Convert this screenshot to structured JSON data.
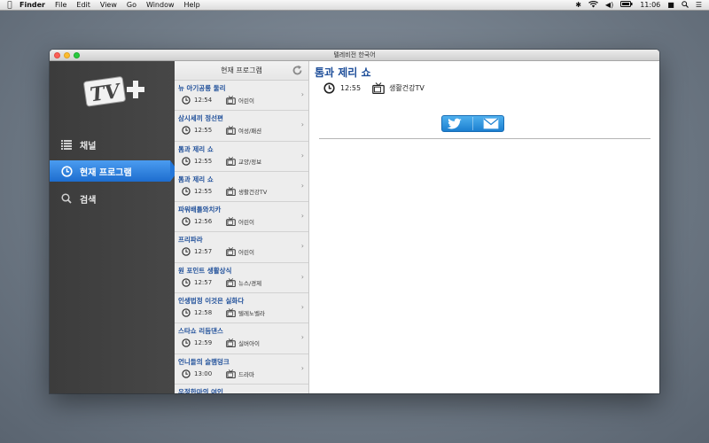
{
  "menubar": {
    "app_name": "Finder",
    "items": [
      "File",
      "Edit",
      "View",
      "Go",
      "Window",
      "Help"
    ],
    "clock": "11:06",
    "icons": [
      "apple-icon",
      "bluetooth-icon",
      "wifi-icon",
      "volume-icon",
      "battery-icon",
      "user-icon",
      "spotlight-icon",
      "notification-list-icon"
    ]
  },
  "window": {
    "title": "텔레비전 한국어"
  },
  "sidebar": {
    "logo_text": "TV",
    "items": [
      {
        "label": "채널",
        "icon": "list-icon"
      },
      {
        "label": "현재 프로그램",
        "icon": "clock-icon",
        "selected": true
      },
      {
        "label": "검색",
        "icon": "search-icon"
      }
    ]
  },
  "list": {
    "header": "현재 프로그램",
    "programs": [
      {
        "name": "뉴 아기공룡 둘리",
        "time": "12:54",
        "genre": "어린이"
      },
      {
        "name": "삼시세끼 정선편",
        "time": "12:55",
        "genre": "여성/패션"
      },
      {
        "name": "톰과 제리 쇼",
        "time": "12:55",
        "genre": "교양/정보"
      },
      {
        "name": "톰과 제리 쇼",
        "time": "12:55",
        "genre": "생활건강TV"
      },
      {
        "name": "파워배틀와치카",
        "time": "12:56",
        "genre": "어린이"
      },
      {
        "name": "프리파라",
        "time": "12:57",
        "genre": "어린이"
      },
      {
        "name": "원 포인트 생활상식",
        "time": "12:57",
        "genre": "뉴스/경제"
      },
      {
        "name": "인생법정 이것은 실화다",
        "time": "12:58",
        "genre": "텔레노벨라"
      },
      {
        "name": "스타쇼 리듬댄스",
        "time": "12:59",
        "genre": "실버아이"
      },
      {
        "name": "언니들의 슬램덩크",
        "time": "13:00",
        "genre": "드라마"
      },
      {
        "name": "우정한마의 여인",
        "time": "",
        "genre": ""
      }
    ]
  },
  "detail": {
    "title": "톰과 제리 쇼",
    "time": "12:55",
    "genre": "생활건강TV"
  },
  "colors": {
    "accent": "#1f4f9a",
    "selection": "#2577d9",
    "sidebar": "#3c3c3c"
  }
}
